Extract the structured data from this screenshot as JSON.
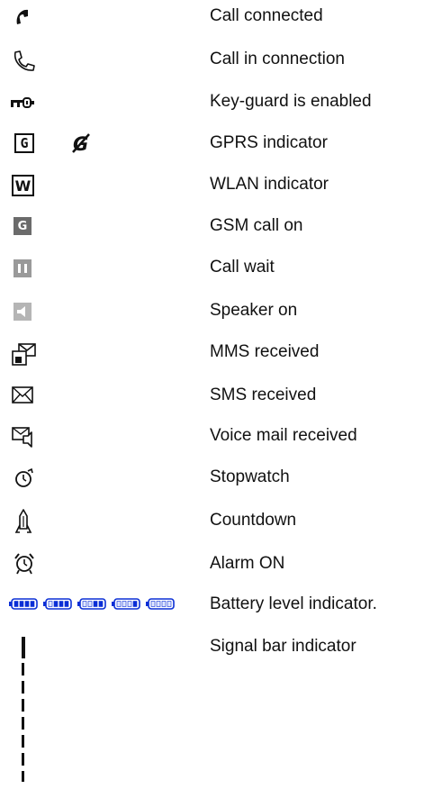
{
  "legend": [
    {
      "icon": "call-connected-icon",
      "label": "Call connected"
    },
    {
      "icon": "call-in-connection-icon",
      "label": "Call in connection"
    },
    {
      "icon": "key-guard-icon",
      "label": "Key-guard is enabled"
    },
    {
      "icon": "gprs-icon",
      "label": "GPRS indicator"
    },
    {
      "icon": "wlan-icon",
      "label": "WLAN indicator"
    },
    {
      "icon": "gsm-call-icon",
      "label": "GSM call on"
    },
    {
      "icon": "call-wait-icon",
      "label": "Call wait"
    },
    {
      "icon": "speaker-icon",
      "label": "Speaker on"
    },
    {
      "icon": "mms-received-icon",
      "label": "MMS received"
    },
    {
      "icon": "sms-received-icon",
      "label": "SMS received"
    },
    {
      "icon": "voice-mail-icon",
      "label": "Voice mail received"
    },
    {
      "icon": "stopwatch-icon",
      "label": "Stopwatch"
    },
    {
      "icon": "countdown-icon",
      "label": "Countdown"
    },
    {
      "icon": "alarm-icon",
      "label": "Alarm ON"
    },
    {
      "icon": "battery-icon",
      "label": "Battery level indicator."
    },
    {
      "icon": "signal-bar-icon",
      "label": "Signal bar indicator"
    }
  ],
  "icon_glyphs": {
    "gprs": "G",
    "wlan": "W",
    "gsm": "G"
  },
  "colors": {
    "battery_blue": "#0a2fd6",
    "icon_gray": "#888888",
    "icon_black": "#111111"
  },
  "battery_levels": [
    1.0,
    0.75,
    0.5,
    0.25,
    0.0
  ]
}
